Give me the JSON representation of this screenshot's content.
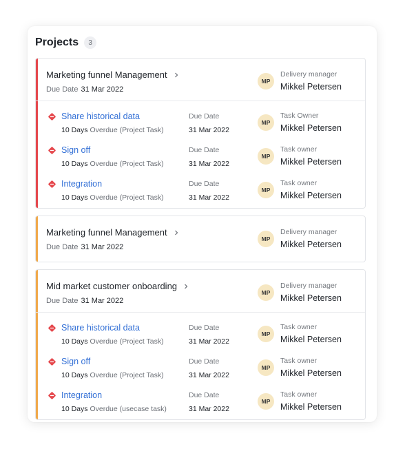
{
  "panel": {
    "title": "Projects",
    "count": "3"
  },
  "colors": {
    "overdue": "#e5484d",
    "warning": "#f0a94b",
    "link": "#3370d6",
    "avatar_bg": "#f6e7c2"
  },
  "projects": [
    {
      "name": "Marketing funnel Management",
      "due_label": "Due Date",
      "due_value": "31 Mar 2022",
      "owner_initials": "MP",
      "owner_role": "Delivery manager",
      "owner_name": "Mikkel Petersen",
      "tasks": [
        {
          "name": "Share historical data",
          "days": "10 Days",
          "overdue_text": "Overdue (Project Task)",
          "due_label": "Due Date",
          "due_value": "31 Mar 2022",
          "owner_initials": "MP",
          "owner_role": "Task Owner",
          "owner_name": "Mikkel Petersen"
        },
        {
          "name": "Sign off",
          "days": "10 Days",
          "overdue_text": "Overdue (Project Task)",
          "due_label": "Due Date",
          "due_value": "31 Mar 2022",
          "owner_initials": "MP",
          "owner_role": "Task owner",
          "owner_name": "Mikkel Petersen"
        },
        {
          "name": "Integration",
          "days": "10 Days",
          "overdue_text": "Overdue (Project Task)",
          "due_label": "Due Date",
          "due_value": "31 Mar 2022",
          "owner_initials": "MP",
          "owner_role": "Task owner",
          "owner_name": "Mikkel Petersen"
        }
      ]
    },
    {
      "name": "Marketing funnel Management",
      "due_label": "Due Date",
      "due_value": "31 Mar 2022",
      "owner_initials": "MP",
      "owner_role": "Delivery manager",
      "owner_name": "Mikkel Petersen",
      "tasks": []
    },
    {
      "name": "Mid market customer onboarding",
      "due_label": "Due Date",
      "due_value": "31 Mar 2022",
      "owner_initials": "MP",
      "owner_role": "Delivery manager",
      "owner_name": "Mikkel Petersen",
      "tasks": [
        {
          "name": "Share historical data",
          "days": "10 Days",
          "overdue_text": "Overdue (Project Task)",
          "due_label": "Due Date",
          "due_value": "31 Mar 2022",
          "owner_initials": "MP",
          "owner_role": "Task owner",
          "owner_name": "Mikkel Petersen"
        },
        {
          "name": "Sign off",
          "days": "10 Days",
          "overdue_text": "Overdue (Project Task)",
          "due_label": "Due Date",
          "due_value": "31 Mar 2022",
          "owner_initials": "MP",
          "owner_role": "Task owner",
          "owner_name": "Mikkel Petersen"
        },
        {
          "name": "Integration",
          "days": "10 Days",
          "overdue_text": "Overdue (usecase task)",
          "due_label": "Due Date",
          "due_value": "31 Mar 2022",
          "owner_initials": "MP",
          "owner_role": "Task owner",
          "owner_name": "Mikkel Petersen"
        }
      ]
    }
  ]
}
